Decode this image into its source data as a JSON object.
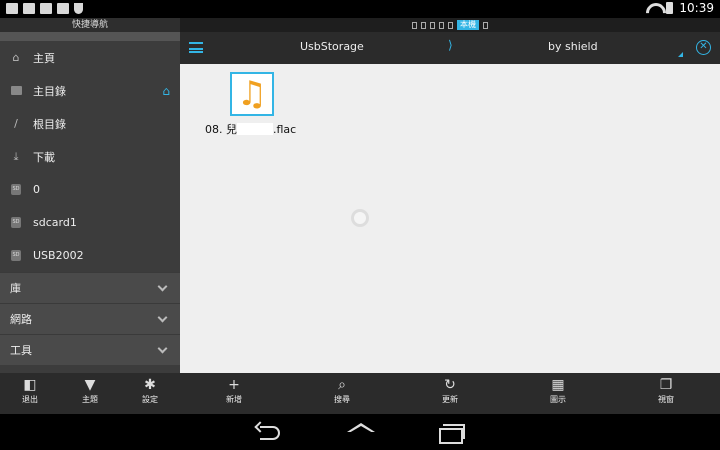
{
  "status": {
    "time": "10:39",
    "icons": [
      "image-icon",
      "mail-icon",
      "mail-icon",
      "check-icon",
      "shield-icon",
      "wifi-icon",
      "battery-icon"
    ]
  },
  "drawer": {
    "title": "快捷導航",
    "items": [
      {
        "label": "主頁",
        "icon": "home-icon"
      },
      {
        "label": "主目錄",
        "icon": "camera-folder-icon"
      },
      {
        "label": "根目錄",
        "icon": "slash-icon"
      },
      {
        "label": "下載",
        "icon": "download-icon"
      },
      {
        "label": "0",
        "icon": "sd-card-icon"
      },
      {
        "label": "sdcard1",
        "icon": "sd-card-icon"
      },
      {
        "label": "USB2002",
        "icon": "sd-card-icon"
      }
    ],
    "sections": [
      {
        "label": "庫"
      },
      {
        "label": "網路"
      },
      {
        "label": "工具"
      }
    ]
  },
  "appbar": {
    "local_tab": "本機",
    "title": "UsbStorage",
    "separator": "⟩",
    "subtitle": "by shield",
    "accent_color": "#33b5e5"
  },
  "content": {
    "file": {
      "name_prefix": "08. 兒",
      "name_suffix": ".flac",
      "icon": "music-note-icon"
    }
  },
  "bottom_left": [
    {
      "label": "退出",
      "icon": "exit-icon"
    },
    {
      "label": "主題",
      "icon": "shirt-icon"
    },
    {
      "label": "設定",
      "icon": "gear-icon"
    }
  ],
  "bottom_main": [
    {
      "label": "新增",
      "icon": "plus-icon"
    },
    {
      "label": "搜尋",
      "icon": "search-icon"
    },
    {
      "label": "更新",
      "icon": "refresh-icon"
    },
    {
      "label": "圖示",
      "icon": "grid-icon"
    },
    {
      "label": "視窗",
      "icon": "windows-icon"
    }
  ]
}
